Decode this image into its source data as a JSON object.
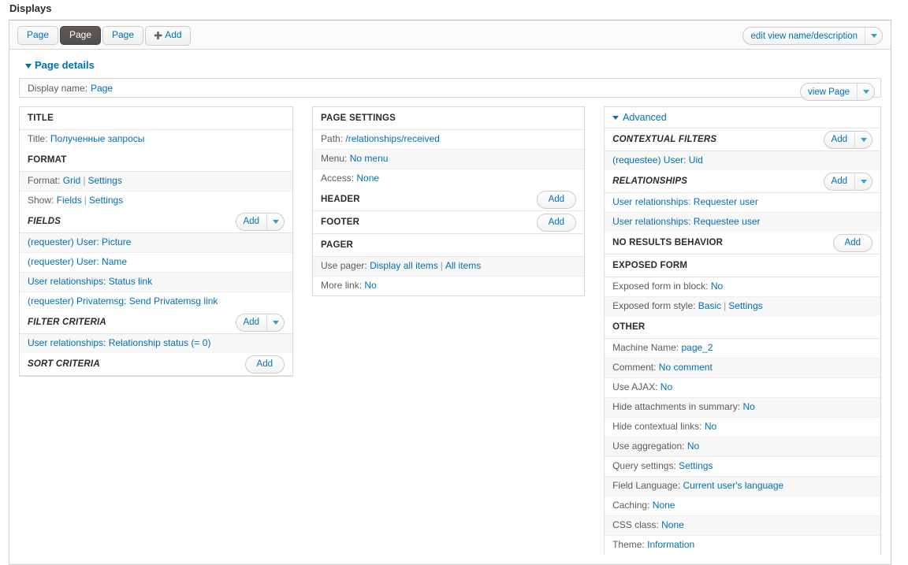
{
  "page": {
    "title": "Displays"
  },
  "tabs": {
    "items": [
      {
        "label": "Page",
        "active": false
      },
      {
        "label": "Page",
        "active": true
      },
      {
        "label": "Page",
        "active": false
      }
    ],
    "add_label": "Add",
    "add_icon": "plus-icon",
    "edit_view_button": {
      "label": "edit view name/description",
      "arrow_icon": "chevron-down-icon"
    }
  },
  "details": {
    "heading": "Page details",
    "toggle_icon": "caret-down-icon",
    "display_name_label": "Display name:",
    "display_name_value": "Page",
    "view_page_button": {
      "label": "view Page",
      "arrow_icon": "chevron-down-icon"
    }
  },
  "left_column": {
    "title_section": {
      "heading": "TITLE",
      "rows": [
        {
          "label": "Title:",
          "links": [
            "Полученные запросы"
          ]
        }
      ]
    },
    "format_section": {
      "heading": "FORMAT",
      "rows": [
        {
          "label": "Format:",
          "links": [
            "Grid",
            "Settings"
          ]
        },
        {
          "label": "Show:",
          "links": [
            "Fields",
            "Settings"
          ]
        }
      ]
    },
    "fields_section": {
      "heading": "FIELDS",
      "add_button": {
        "label": "Add",
        "arrow_icon": "chevron-down-icon"
      },
      "items": [
        "(requester) User: Picture",
        "(requester) User: Name",
        "User relationships: Status link",
        "(requester) Privatemsg: Send Privatemsg link"
      ]
    },
    "filter_section": {
      "heading": "FILTER CRITERIA",
      "add_button": {
        "label": "Add",
        "arrow_icon": "chevron-down-icon"
      },
      "items": [
        "User relationships: Relationship status (= 0)"
      ]
    },
    "sort_section": {
      "heading": "SORT CRITERIA",
      "add_button": {
        "label": "Add"
      },
      "items": []
    }
  },
  "middle_column": {
    "page_settings": {
      "heading": "PAGE SETTINGS",
      "rows": [
        {
          "label": "Path:",
          "links": [
            "/relationships/received"
          ]
        },
        {
          "label": "Menu:",
          "links": [
            "No menu"
          ]
        },
        {
          "label": "Access:",
          "links": [
            "None"
          ]
        }
      ]
    },
    "header_section": {
      "heading": "HEADER",
      "add_button": {
        "label": "Add"
      }
    },
    "footer_section": {
      "heading": "FOOTER",
      "add_button": {
        "label": "Add"
      }
    },
    "pager_section": {
      "heading": "PAGER",
      "rows": [
        {
          "label": "Use pager:",
          "links": [
            "Display all items",
            "All items"
          ]
        },
        {
          "label": "More link:",
          "links": [
            "No"
          ]
        }
      ]
    }
  },
  "right_column": {
    "advanced": {
      "heading": "Advanced",
      "toggle_icon": "caret-down-icon"
    },
    "contextual_filters": {
      "heading": "CONTEXTUAL FILTERS",
      "add_button": {
        "label": "Add",
        "arrow_icon": "chevron-down-icon"
      },
      "items": [
        "(requestee) User: Uid"
      ]
    },
    "relationships": {
      "heading": "RELATIONSHIPS",
      "add_button": {
        "label": "Add",
        "arrow_icon": "chevron-down-icon"
      },
      "items": [
        "User relationships: Requester user",
        "User relationships: Requestee user"
      ]
    },
    "no_results_behavior": {
      "heading": "NO RESULTS BEHAVIOR",
      "add_button": {
        "label": "Add"
      },
      "items": []
    },
    "exposed_form": {
      "heading": "EXPOSED FORM",
      "rows": [
        {
          "label": "Exposed form in block:",
          "links": [
            "No"
          ]
        },
        {
          "label": "Exposed form style:",
          "links": [
            "Basic",
            "Settings"
          ]
        }
      ]
    },
    "other": {
      "heading": "OTHER",
      "rows": [
        {
          "label": "Machine Name:",
          "links": [
            "page_2"
          ]
        },
        {
          "label": "Comment:",
          "links": [
            "No comment"
          ]
        },
        {
          "label": "Use AJAX:",
          "links": [
            "No"
          ]
        },
        {
          "label": "Hide attachments in summary:",
          "links": [
            "No"
          ]
        },
        {
          "label": "Hide contextual links:",
          "links": [
            "No"
          ]
        },
        {
          "label": "Use aggregation:",
          "links": [
            "No"
          ]
        },
        {
          "label": "Query settings:",
          "links": [
            "Settings"
          ]
        },
        {
          "label": "Field Language:",
          "links": [
            "Current user's language"
          ]
        },
        {
          "label": "Caching:",
          "links": [
            "None"
          ]
        },
        {
          "label": "CSS class:",
          "links": [
            "None"
          ]
        },
        {
          "label": "Theme:",
          "links": [
            "Information"
          ]
        }
      ]
    }
  },
  "colors": {
    "link": "#0071b3",
    "active_tab_bg": "#585452",
    "label": "#5c5c5c",
    "alt_row": "#f7f7f7",
    "border": "#d9d9d9"
  }
}
